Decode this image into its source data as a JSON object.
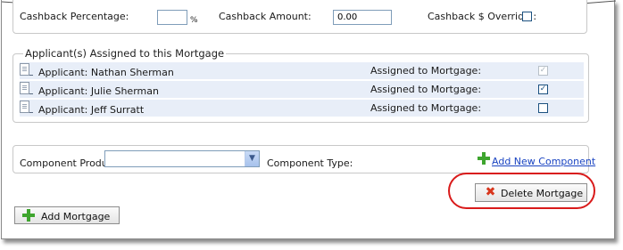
{
  "cashback": {
    "percentage_label": "Cashback Percentage:",
    "percentage_value": "",
    "percent_sign": "%",
    "amount_label": "Cashback Amount:",
    "amount_value": "0.00",
    "override_label": "Cashback $ Override :",
    "override_checked": false
  },
  "applicants": {
    "legend": "Applicant(s) Assigned to this Mortgage",
    "assigned_label": "Assigned to Mortgage:",
    "rows": [
      {
        "name": "Applicant: Nathan Sherman",
        "assigned": true,
        "disabled": true
      },
      {
        "name": "Applicant: Julie Sherman",
        "assigned": true,
        "disabled": false
      },
      {
        "name": "Applicant: Jeff Surratt",
        "assigned": false,
        "disabled": false
      }
    ]
  },
  "component": {
    "product_label": "Component Product:",
    "product_value": "",
    "type_label": "Component Type:",
    "add_link": "Add New Component"
  },
  "actions": {
    "delete_label": "Delete Mortgage",
    "add_label": "Add Mortgage"
  },
  "colors": {
    "link": "#1a44c2",
    "highlight_circle": "#d91a1a",
    "row_bg": "#e8eef8",
    "plus_green": "#3ea52e",
    "delete_red": "#d8361d"
  }
}
